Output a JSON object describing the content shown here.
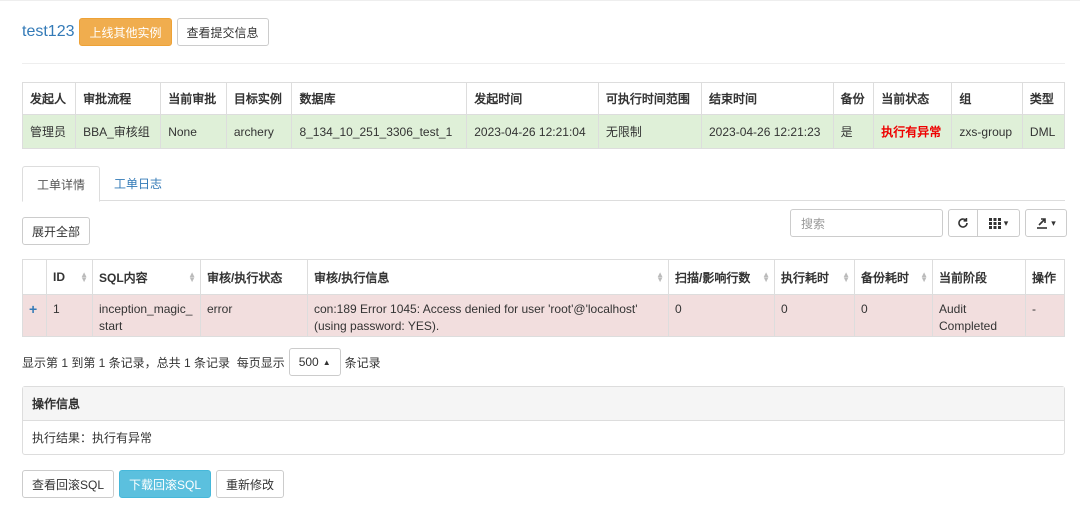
{
  "header": {
    "title": "test123",
    "online_other_btn": "上线其他实例",
    "view_submit_btn": "查看提交信息"
  },
  "info_table": {
    "headers": [
      "发起人",
      "审批流程",
      "当前审批",
      "目标实例",
      "数据库",
      "发起时间",
      "可执行时间范围",
      "结束时间",
      "备份",
      "当前状态",
      "组",
      "类型"
    ],
    "row": [
      "管理员",
      "BBA_审核组",
      "None",
      "archery",
      "8_134_10_251_3306_test_1",
      "2023-04-26 12:21:04",
      "无限制",
      "2023-04-26 12:21:23",
      "是",
      "执行有异常",
      "zxs-group",
      "DML"
    ]
  },
  "tabs": [
    "工单详情",
    "工单日志"
  ],
  "expand_all": "展开全部",
  "toolbar": {
    "search_placeholder": "搜索",
    "refresh_icon": "refresh-icon",
    "columns_icon": "columns-icon",
    "export_icon": "export-icon",
    "caret": "▾"
  },
  "data_table": {
    "headers": [
      "",
      "ID",
      "SQL内容",
      "审核/执行状态",
      "审核/执行信息",
      "扫描/影响行数",
      "执行耗时",
      "备份耗时",
      "当前阶段",
      "操作"
    ],
    "rows": [
      {
        "expander": "+",
        "id": "1",
        "sql": "inception_magic_start",
        "status": "error",
        "message": "con:189 Error 1045: Access denied for user 'root'@'localhost' (using password: YES).",
        "affected": "0",
        "exec_time": "0",
        "backup_time": "0",
        "stage": "Audit Completed",
        "op": "-"
      }
    ]
  },
  "pager": {
    "summary": "显示第 1 到第 1 条记录，总共 1 条记录  每页显示",
    "page_size": "500",
    "suffix": "条记录"
  },
  "panel": {
    "title": "操作信息",
    "body": "执行结果：执行有异常"
  },
  "actions": {
    "view_rollback": "查看回滚SQL",
    "download_rollback": "下载回滚SQL",
    "re_edit": "重新修改"
  },
  "colors": {
    "primary": "#337ab7",
    "warning": "#f0ad4e",
    "info": "#5bc0de",
    "success_row": "#dff0d8",
    "danger_row": "#f2dede",
    "danger_text": "#ee0000"
  }
}
